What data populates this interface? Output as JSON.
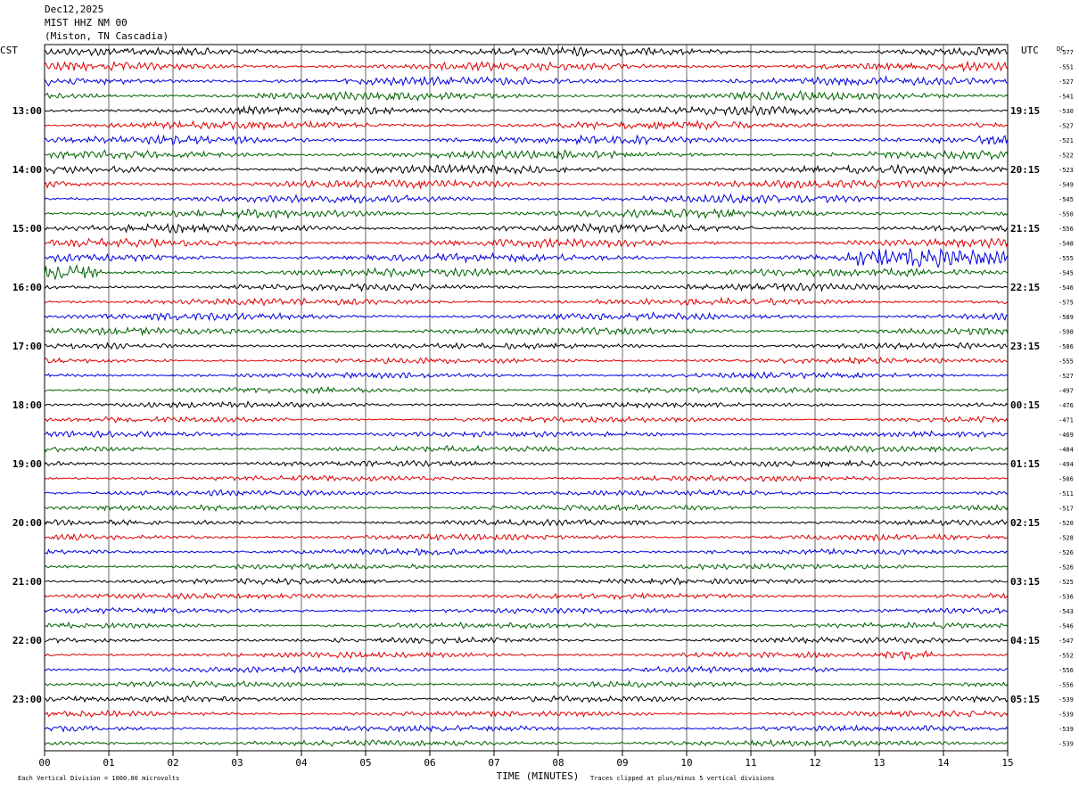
{
  "header": {
    "date": "Dec12,2025",
    "station": "MIST HHZ NM 00",
    "location": "(Miston, TN Cascadia)"
  },
  "left_zone": "CST",
  "right_zone": "UTC",
  "dc_label": "DC",
  "footer": {
    "scale_note": "Each Vertical Division = 1000.00 microvolts",
    "xlabel": "TIME (MINUTES)",
    "clip_note": "Traces clipped at plus/minus 5 vertical divisions"
  },
  "colors": {
    "trace_cycle": [
      "#000000",
      "#e00000",
      "#0000e0",
      "#006400"
    ],
    "grid": "#000000"
  },
  "chart_data": {
    "type": "line",
    "title": "",
    "xlabel": "TIME (MINUTES)",
    "xlim": [
      0,
      15
    ],
    "x_ticks": [
      "00",
      "01",
      "02",
      "03",
      "04",
      "05",
      "06",
      "07",
      "08",
      "09",
      "10",
      "11",
      "12",
      "13",
      "14",
      "15"
    ],
    "left_time_labels": [
      "13:00",
      "14:00",
      "15:00",
      "16:00",
      "17:00",
      "18:00",
      "19:00",
      "20:00",
      "21:00",
      "22:00",
      "23:00"
    ],
    "right_time_labels": [
      "19:15",
      "20:15",
      "21:15",
      "22:15",
      "23:15",
      "00:15",
      "01:15",
      "02:15",
      "03:15",
      "04:15",
      "05:15"
    ],
    "trace_count": 48,
    "dc_offsets": [
      -577,
      -551,
      -527,
      -541,
      -530,
      -527,
      -521,
      -522,
      -523,
      -549,
      -545,
      -550,
      -556,
      -548,
      -555,
      -545,
      -546,
      -575,
      -589,
      -598,
      -586,
      -555,
      -527,
      -497,
      -476,
      -471,
      -469,
      -484,
      -494,
      -506,
      -511,
      -517,
      -520,
      -528,
      -526,
      -526,
      -525,
      -536,
      -543,
      -546,
      -547,
      -552,
      -556,
      -556,
      -539,
      -539,
      -539,
      -539
    ]
  }
}
